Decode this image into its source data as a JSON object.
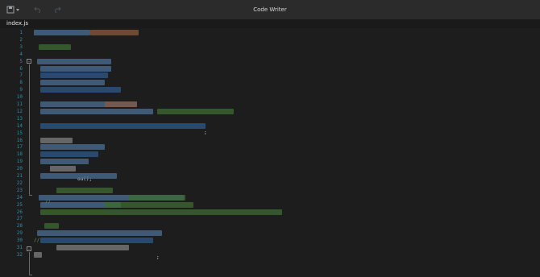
{
  "app_title": "Code Writer",
  "file_tab": "index.js",
  "line_numbers": [
    "1",
    "2",
    "3",
    "4",
    "5",
    "6",
    "7",
    "8",
    "9",
    "10",
    "11",
    "12",
    "13",
    "14",
    "15",
    "16",
    "17",
    "18",
    "19",
    "20",
    "21",
    "22",
    "23",
    "24",
    "25",
    "26",
    "27",
    "28",
    "29",
    "30",
    "31",
    "32"
  ],
  "fold_markers": [
    "-",
    "-"
  ],
  "visible_tokens": {
    "comment_slashes_a": "//",
    "comment_slashes_b": "//",
    "line20_suffix": "ou();",
    "line14_suffix": ";",
    "line30_suffix": ";"
  },
  "colors": {
    "line_number": "#2a8fb0",
    "keyword": "#2c5a8a",
    "identifier": "#4a6f95",
    "string": "#8a5a3c",
    "comment": "#3d6b30",
    "plain": "#7f7f7f"
  }
}
